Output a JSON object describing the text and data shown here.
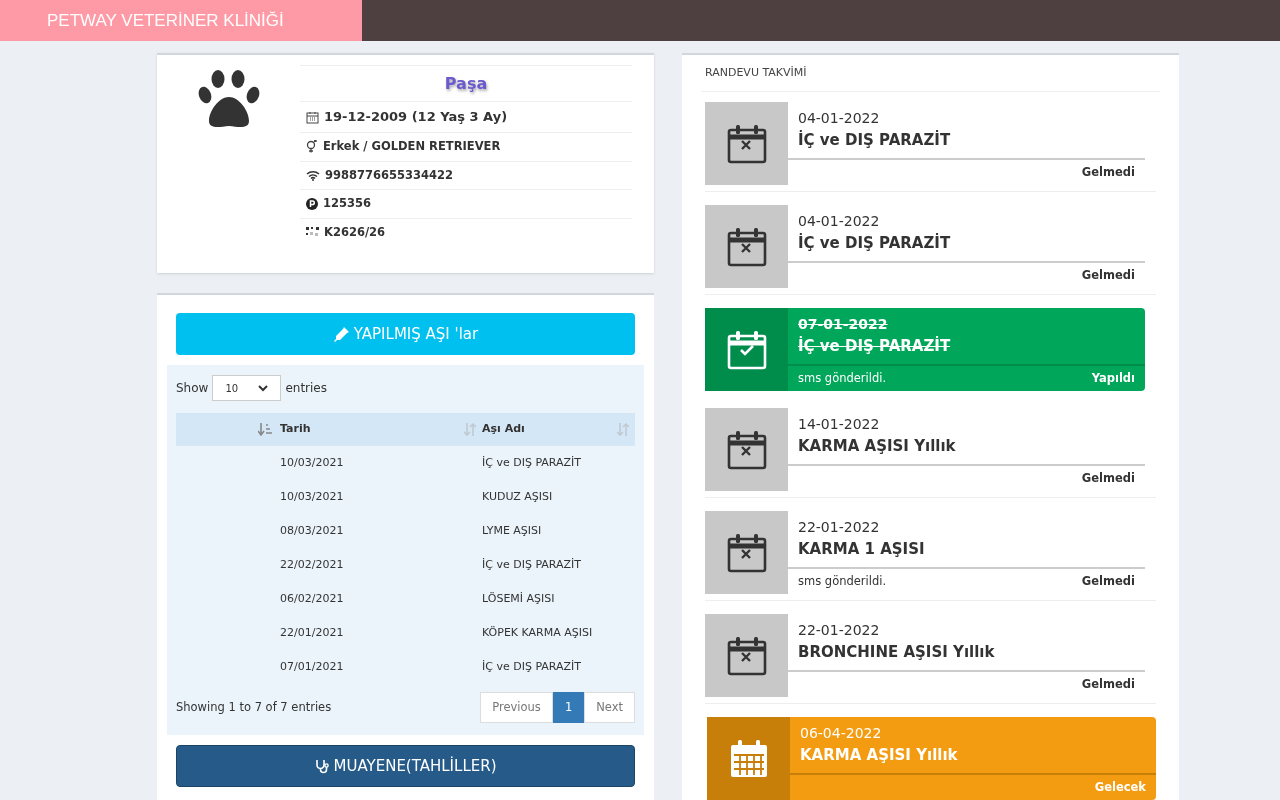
{
  "header": {
    "title": "PETWAY VETERİNER KLİNİĞİ"
  },
  "pet": {
    "name": "Paşa",
    "details": [
      {
        "kind": "birth",
        "text": "19-12-2009 (12 Yaş 3 Ay)"
      },
      {
        "kind": "sex",
        "text": "Erkek / GOLDEN RETRIEVER"
      },
      {
        "kind": "chip",
        "text": "9988776655334422"
      },
      {
        "kind": "passport",
        "text": "125356"
      },
      {
        "kind": "code",
        "text": "K2626/26"
      }
    ]
  },
  "vaccines": {
    "button": "YAPILMIŞ AŞI 'lar",
    "show_label": "Show",
    "page_size": "10",
    "entries_label": "entries",
    "columns": [
      "Tarih",
      "Aşı Adı"
    ],
    "rows": [
      [
        "10/03/2021",
        "İÇ ve DIŞ PARAZİT"
      ],
      [
        "10/03/2021",
        "KUDUZ AŞISI"
      ],
      [
        "08/03/2021",
        "LYME AŞISI"
      ],
      [
        "22/02/2021",
        "İÇ ve DIŞ PARAZİT"
      ],
      [
        "06/02/2021",
        "LÖSEMİ AŞISI"
      ],
      [
        "22/01/2021",
        "KÖPEK KARMA AŞISI"
      ],
      [
        "07/01/2021",
        "İÇ ve DIŞ PARAZİT"
      ]
    ],
    "info": "Showing 1 to 7 of 7 entries",
    "pagination": [
      {
        "label": "Previous",
        "selected": false
      },
      {
        "label": "1",
        "selected": true
      },
      {
        "label": "Next",
        "selected": false
      }
    ]
  },
  "exam_button": "MUAYENE(TAHLİLLER)",
  "appointments": {
    "title": "RANDEVU TAKVİMİ",
    "items": [
      {
        "kind": "missed",
        "date": "04-01-2022",
        "title": "İÇ ve DIŞ PARAZİT",
        "status": "Gelmedi"
      },
      {
        "kind": "missed",
        "date": "04-01-2022",
        "title": "İÇ ve DIŞ PARAZİT",
        "status": "Gelmedi"
      },
      {
        "kind": "done",
        "date": "07-01-2022",
        "title": "İÇ ve DIŞ PARAZİT",
        "note": "sms gönderildi.",
        "status": "Yapıldı"
      },
      {
        "kind": "missed",
        "date": "14-01-2022",
        "title": "KARMA AŞISI Yıllık",
        "status": "Gelmedi"
      },
      {
        "kind": "missed",
        "date": "22-01-2022",
        "title": "KARMA 1 AŞISI",
        "note": "sms gönderildi.",
        "status": "Gelmedi"
      },
      {
        "kind": "missed",
        "date": "22-01-2022",
        "title": "BRONCHINE AŞISI Yıllık",
        "status": "Gelmedi"
      },
      {
        "kind": "upcoming",
        "date": "06-04-2022",
        "title": "KARMA AŞISI Yıllık",
        "status": "Gelecek"
      }
    ]
  }
}
